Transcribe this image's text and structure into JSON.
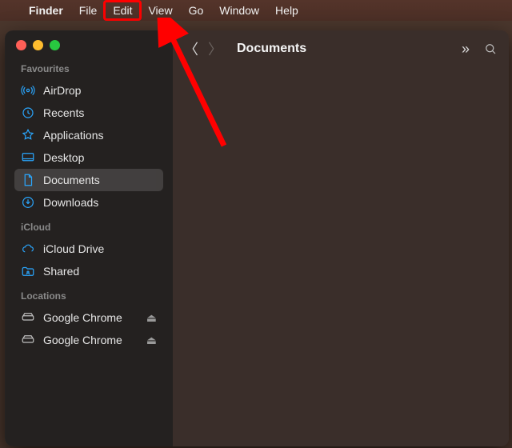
{
  "menubar": {
    "app": "Finder",
    "items": [
      "File",
      "Edit",
      "View",
      "Go",
      "Window",
      "Help"
    ],
    "highlighted_index": 1
  },
  "toolbar": {
    "title": "Documents"
  },
  "sidebar": {
    "sections": [
      {
        "label": "Favourites",
        "items": [
          {
            "icon": "airdrop",
            "label": "AirDrop"
          },
          {
            "icon": "recents",
            "label": "Recents"
          },
          {
            "icon": "applications",
            "label": "Applications"
          },
          {
            "icon": "desktop",
            "label": "Desktop"
          },
          {
            "icon": "documents",
            "label": "Documents",
            "selected": true
          },
          {
            "icon": "downloads",
            "label": "Downloads"
          }
        ]
      },
      {
        "label": "iCloud",
        "items": [
          {
            "icon": "cloud",
            "label": "iCloud Drive"
          },
          {
            "icon": "shared",
            "label": "Shared"
          }
        ]
      },
      {
        "label": "Locations",
        "items": [
          {
            "icon": "disk",
            "label": "Google Chrome",
            "eject": true
          },
          {
            "icon": "disk",
            "label": "Google Chrome",
            "eject": true
          }
        ]
      }
    ]
  },
  "annotation": {
    "highlight_menu": "Edit",
    "arrow_color": "#ff0000"
  }
}
